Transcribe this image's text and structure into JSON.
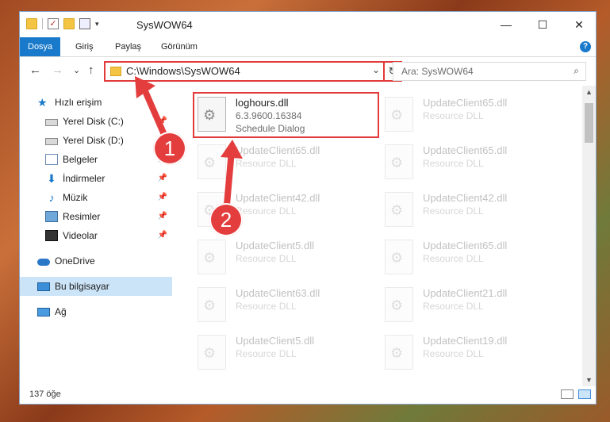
{
  "window": {
    "title": "SysWOW64",
    "controls": {
      "minimize": "—",
      "maximize": "☐",
      "close": "✕"
    }
  },
  "ribbon": {
    "tabs": [
      {
        "label": "Dosya",
        "active": true
      },
      {
        "label": "Giriş"
      },
      {
        "label": "Paylaş"
      },
      {
        "label": "Görünüm"
      }
    ],
    "help": "?"
  },
  "nav": {
    "back": "←",
    "forward": "→",
    "recent": "⌄",
    "up": "↑",
    "address": "C:\\Windows\\SysWOW64",
    "address_dropdown": "⌄",
    "refresh": "↻",
    "search_placeholder": "Ara: SysWOW64",
    "search_icon": "⌕"
  },
  "sidebar": {
    "items": [
      {
        "label": "Hızlı erişim",
        "icon": "star-icon"
      },
      {
        "label": "Yerel Disk (C:)",
        "icon": "disk-icon",
        "pinned": true
      },
      {
        "label": "Yerel Disk (D:)",
        "icon": "disk-icon",
        "pinned": true
      },
      {
        "label": "Belgeler",
        "icon": "documents-icon",
        "pinned": true
      },
      {
        "label": "İndirmeler",
        "icon": "download-icon",
        "pinned": true
      },
      {
        "label": "Müzik",
        "icon": "music-icon",
        "pinned": true
      },
      {
        "label": "Resimler",
        "icon": "pictures-icon",
        "pinned": true
      },
      {
        "label": "Videolar",
        "icon": "video-icon",
        "pinned": true
      },
      {
        "label": "OneDrive",
        "icon": "cloud-icon"
      },
      {
        "label": "Bu bilgisayar",
        "icon": "computer-icon",
        "selected": true
      },
      {
        "label": "Ağ",
        "icon": "network-icon"
      }
    ],
    "pin_glyph": "📌"
  },
  "files": [
    {
      "name": "loghours.dll",
      "version": "6.3.9600.16384",
      "description": "Schedule Dialog",
      "highlighted": true
    },
    {
      "name": "UpdateClient65.dll",
      "description": "Resource DLL"
    },
    {
      "name": "UpdateClient65.dll",
      "description": "Resource DLL"
    },
    {
      "name": "UpdateClient65.dll",
      "description": "Resource DLL"
    },
    {
      "name": "UpdateClient42.dll",
      "description": "Resource DLL"
    },
    {
      "name": "UpdateClient42.dll",
      "description": "Resource DLL"
    },
    {
      "name": "UpdateClient5.dll",
      "description": "Resource DLL"
    },
    {
      "name": "UpdateClient65.dll",
      "description": "Resource DLL"
    },
    {
      "name": "UpdateClient63.dll",
      "description": "Resource DLL"
    },
    {
      "name": "UpdateClient21.dll",
      "description": "Resource DLL"
    },
    {
      "name": "UpdateClient5.dll",
      "description": "Resource DLL"
    },
    {
      "name": "UpdateClient19.dll",
      "description": "Resource DLL"
    }
  ],
  "status": {
    "item_count": "137 öğe"
  },
  "callouts": [
    {
      "label": "1"
    },
    {
      "label": "2"
    }
  ],
  "colors": {
    "accent": "#1979ca",
    "highlight": "#e23a3a",
    "selected_bg": "#cce4f7"
  }
}
